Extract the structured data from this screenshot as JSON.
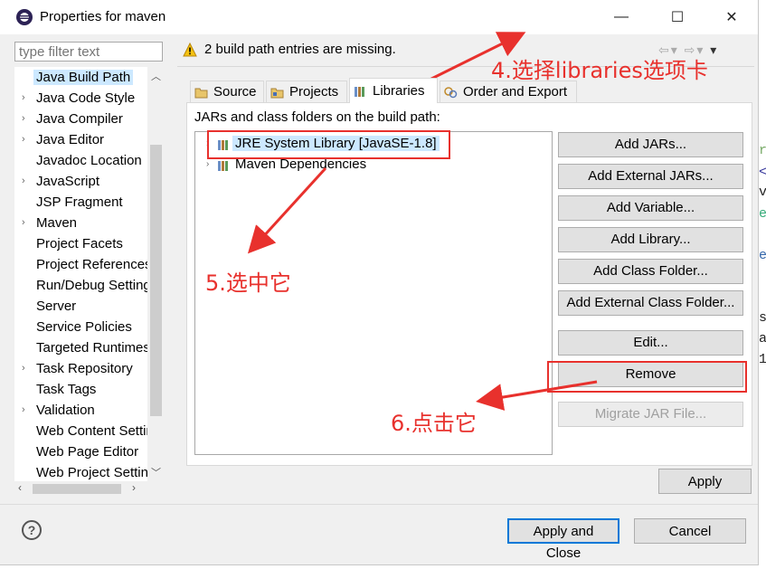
{
  "window": {
    "title": "Properties for maven",
    "minimize": "—",
    "maximize": "☐",
    "close": "✕"
  },
  "sidebar": {
    "filter_placeholder": "type filter text",
    "items": [
      {
        "label": "Java Build Path",
        "expandable": false,
        "selected": true
      },
      {
        "label": "Java Code Style",
        "expandable": true
      },
      {
        "label": "Java Compiler",
        "expandable": true
      },
      {
        "label": "Java Editor",
        "expandable": true
      },
      {
        "label": "Javadoc Location",
        "expandable": false
      },
      {
        "label": "JavaScript",
        "expandable": true
      },
      {
        "label": "JSP Fragment",
        "expandable": false
      },
      {
        "label": "Maven",
        "expandable": true
      },
      {
        "label": "Project Facets",
        "expandable": false
      },
      {
        "label": "Project References",
        "expandable": false
      },
      {
        "label": "Run/Debug Settings",
        "expandable": false
      },
      {
        "label": "Server",
        "expandable": false
      },
      {
        "label": "Service Policies",
        "expandable": false
      },
      {
        "label": "Targeted Runtimes",
        "expandable": false
      },
      {
        "label": "Task Repository",
        "expandable": true
      },
      {
        "label": "Task Tags",
        "expandable": false
      },
      {
        "label": "Validation",
        "expandable": true
      },
      {
        "label": "Web Content Settings",
        "expandable": false
      },
      {
        "label": "Web Page Editor",
        "expandable": false
      },
      {
        "label": "Web Project Settings",
        "expandable": false
      }
    ]
  },
  "main": {
    "warning": "2 build path entries are missing.",
    "tabs": [
      {
        "label": "Source"
      },
      {
        "label": "Projects"
      },
      {
        "label": "Libraries",
        "active": true
      },
      {
        "label": "Order and Export"
      }
    ],
    "panel_label": "JARs and class folders on the build path:",
    "libraries": [
      {
        "label": "JRE System Library [JavaSE-1.8]",
        "selected": true
      },
      {
        "label": "Maven Dependencies"
      }
    ],
    "buttons": {
      "add_jars": "Add JARs...",
      "add_external_jars": "Add External JARs...",
      "add_variable": "Add Variable...",
      "add_library": "Add Library...",
      "add_class_folder": "Add Class Folder...",
      "add_external_class_folder": "Add External Class Folder...",
      "edit": "Edit...",
      "remove": "Remove",
      "migrate_jar": "Migrate JAR File..."
    },
    "apply": "Apply"
  },
  "footer": {
    "help": "?",
    "apply_and_close": "Apply and Close",
    "cancel": "Cancel"
  },
  "annotations": {
    "step4": "4.选择libraries选项卡",
    "step5": "5.选中它",
    "step6": "6.点击它"
  },
  "colors": {
    "annotation": "#e8312d",
    "selection": "#cce8ff",
    "default_button_border": "#0078d7"
  }
}
